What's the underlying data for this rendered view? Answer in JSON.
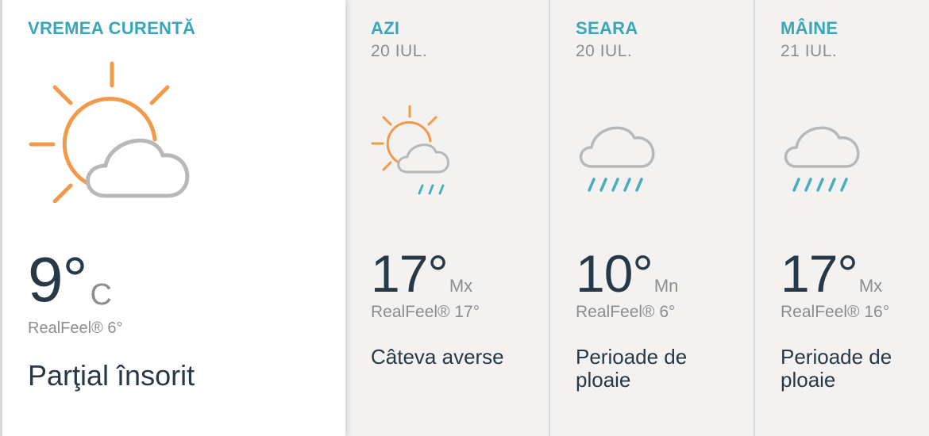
{
  "current": {
    "title": "VREMEA CURENTĂ",
    "temp": "9°",
    "unit": "C",
    "realfeel": "RealFeel® 6°",
    "phrase": "Parţial însorit",
    "icon": "partly-sunny-icon"
  },
  "forecast": [
    {
      "title": "AZI",
      "date": "20 IUL.",
      "temp": "17°",
      "unit": "Mx",
      "realfeel": "RealFeel® 17°",
      "phrase": "Câteva averse",
      "icon": "sun-cloud-rain-icon"
    },
    {
      "title": "SEARA",
      "date": "20 IUL.",
      "temp": "10°",
      "unit": "Mn",
      "realfeel": "RealFeel® 6°",
      "phrase": "Perioade de ploaie",
      "icon": "cloud-rain-icon"
    },
    {
      "title": "MÂINE",
      "date": "21 IUL.",
      "temp": "17°",
      "unit": "Mx",
      "realfeel": "RealFeel® 16°",
      "phrase": "Perioade de ploaie",
      "icon": "cloud-rain-icon"
    }
  ],
  "colors": {
    "accent": "#3aa6b9",
    "sun": "#f29a4a",
    "cloud": "#b8b8b8",
    "rain": "#47aebf",
    "text_dark": "#273847",
    "text_muted": "#8d8d8d"
  }
}
